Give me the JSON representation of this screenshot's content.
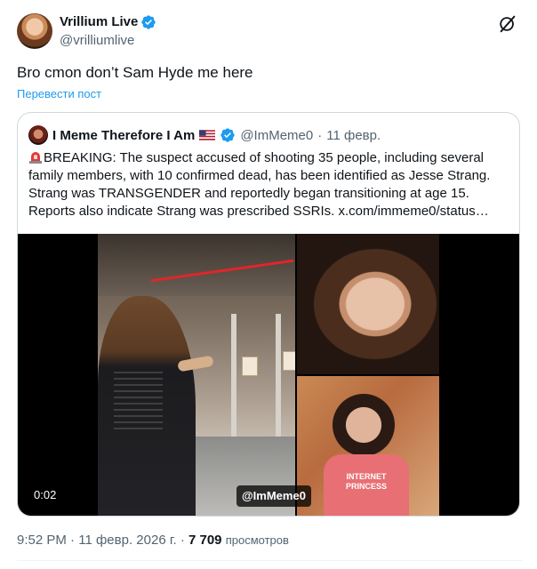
{
  "author": {
    "display_name": "Vrillium Live",
    "handle": "@vrilliumlive",
    "verified": true,
    "avatar_icon": "profile-photo"
  },
  "tweet": {
    "text": "Bro cmon don’t Sam Hyde me here",
    "translate_label": "Перевести пост"
  },
  "quote": {
    "display_name": "I Meme Therefore I Am",
    "flag_icon": "us-flag-icon",
    "handle": "@ImMeme0",
    "separator": "·",
    "date": "11 февр.",
    "siren_icon": "police-light-icon",
    "text": "BREAKING: The suspect accused of shooting 35 people, including several family members, with 10 confirmed dead, has been identified as Jesse Strang. Strang was TRANSGENDER and reportedly began transitioning at age 15. Reports also indicate Strang was prescribed SSRIs.  x.com/immeme0/status…",
    "media": {
      "video_time": "0:02",
      "watermark": "@ImMeme0",
      "photo_caption": "INTERNET PRINCESS"
    }
  },
  "meta": {
    "time": "9:52 PM",
    "sep1": "·",
    "date": "11 февр. 2026 г.",
    "sep2": "·",
    "views": "7 709",
    "views_label": "просмотров"
  },
  "colors": {
    "accent": "#1d9bf0",
    "secondary_text": "#536471",
    "border": "#cfd9de"
  }
}
